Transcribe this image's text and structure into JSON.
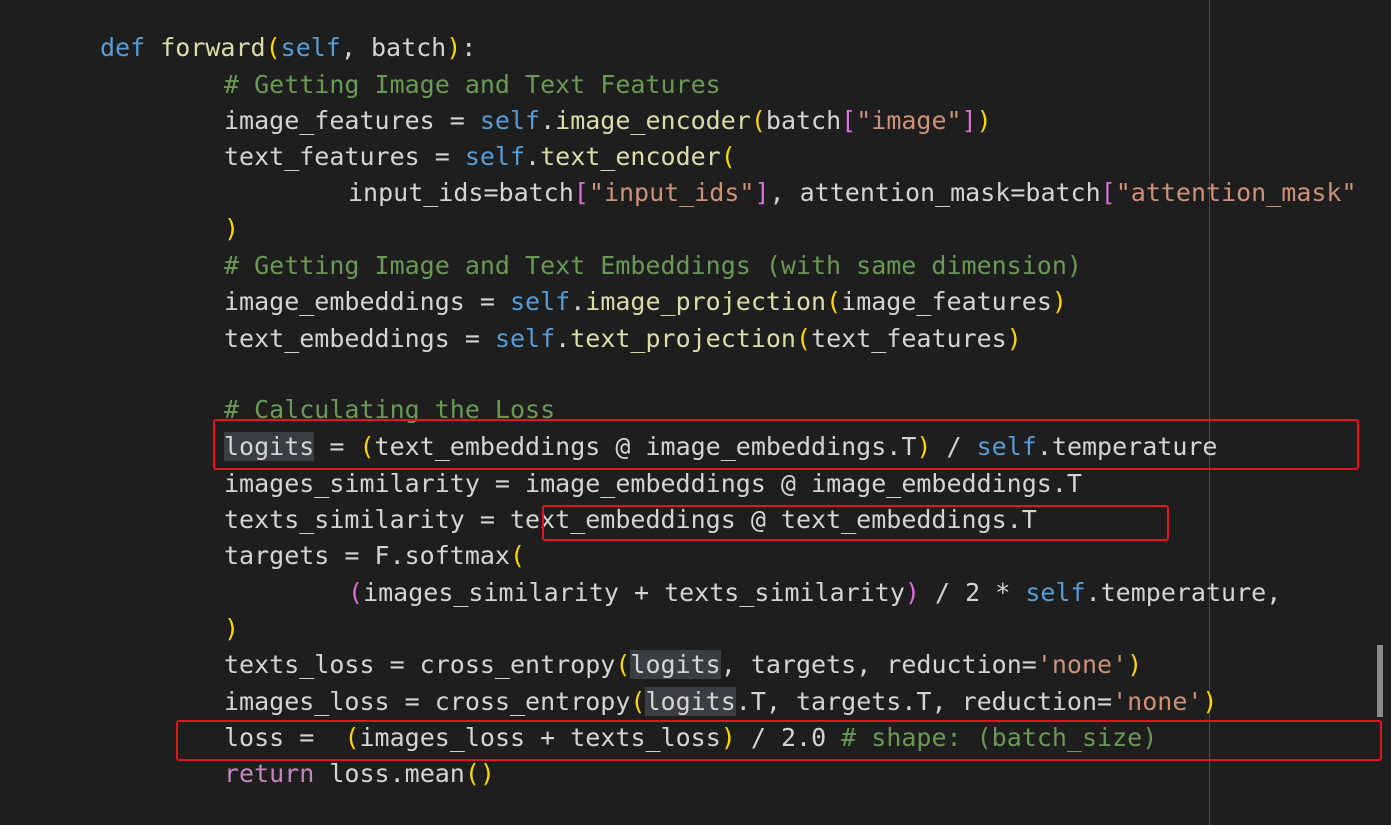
{
  "code": {
    "def_kw": "def",
    "fn_name": "forward",
    "self": "self",
    "batch": "batch",
    "cmt_features": "# Getting Image and Text Features",
    "image_features": "image_features",
    "text_features": "text_features",
    "image_encoder": "image_encoder",
    "text_encoder": "text_encoder",
    "str_image": "\"image\"",
    "input_ids_kw": "input_ids",
    "str_input_ids": "\"input_ids\"",
    "attention_mask_kw": "attention_mask",
    "str_attention_mask": "\"attention_mask\"",
    "cmt_embeddings": "# Getting Image and Text Embeddings (with same dimension)",
    "image_embeddings": "image_embeddings",
    "text_embeddings": "text_embeddings",
    "image_projection": "image_projection",
    "text_projection": "text_projection",
    "cmt_loss": "# Calculating the Loss",
    "logits": "logits",
    "temperature": "temperature",
    "images_similarity": "images_similarity",
    "texts_similarity": "texts_similarity",
    "targets": "targets",
    "softmax": "F.softmax",
    "texts_loss": "texts_loss",
    "images_loss": "images_loss",
    "cross_entropy": "cross_entropy",
    "reduction": "reduction",
    "str_none": "'none'",
    "loss": "loss",
    "cmt_shape": "# shape: (batch_size)",
    "return_kw": "return",
    "mean": "mean"
  },
  "colors": {
    "background": "#1e1e1e",
    "highlight_box": "#e81123"
  }
}
